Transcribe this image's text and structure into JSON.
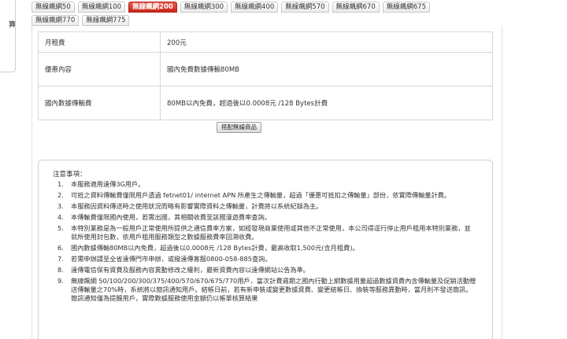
{
  "sidebar": {
    "partial_label": "算"
  },
  "tabs": [
    [
      "無線飆網50",
      "無線飆網100",
      "無線飆網200",
      "無線飆網300",
      "無線飆網400",
      "無線飆網570",
      "無線飆網670",
      "無線飆網675"
    ],
    [
      "無線飆網770",
      "無線飆網775"
    ]
  ],
  "active_tab": "無線飆網200",
  "plan_table": [
    {
      "label": "月租費",
      "value": "200元"
    },
    {
      "label": "優惠內容",
      "value": "國內免費數據傳輸80MB"
    },
    {
      "label": "國內數據傳輸費",
      "value": "80MB以內免費，超過後以0.0008元 /128 Bytes計費"
    }
  ],
  "compare_button": "搭配無線商品",
  "notes": {
    "title": "注意事項：",
    "items": [
      "本服務適用遠傳3G用戶。",
      "可抵之資料傳輸費僅限用戶透過 fetnet01/ internet APN 所產生之傳輸量，超過「優惠可抵扣之傳輸量」部份，依實際傳輸量計費。",
      "本服務因資料傳送時之使用狀況而略有影響實際資料之傳輸量，計費將以系統紀錄為主。",
      "本傳輸費僅限國內使用，若需出國，其相關收費至該國漫遊費率查詢。",
      "本特別業務是為一般用戶正常使用所提供之通信費率方案，如經發現商業使用或其他不正常使用，本公司得逕行停止用戶租用本特別業務，並就所使用封包數，依用戶租用服務類型之數據服務費率回溯收費。",
      "國內數據傳輸80MB以內免費，超過後以0.0008元 /128 Bytes計費，最高收取1,500元(含月租費)。",
      "若需申辦請至全省遠傳門市申辦，或撥遠傳客服0800-058-885查詢。",
      "遠傳電信保有資費及服務內容異動修改之權利，最新資費內容以遠傳網站公告為準。",
      "無線飆網 50/100/200/300/375/400/570/670/675/770用戶，當次計費週期之國內行動上網數據用量超過數據資費內含傳輸量及促銷活動贈送傳輸量之70%時，系統將以簡訊通知用戶。結帳日前，若有新申裝或變更數據資費、變更結帳日、換裝等服務異動時，當月則不發送簡訊。簡訊通知僅為提醒用戶，實際數據服務使用金額仍以帳單核算結果"
    ]
  }
}
